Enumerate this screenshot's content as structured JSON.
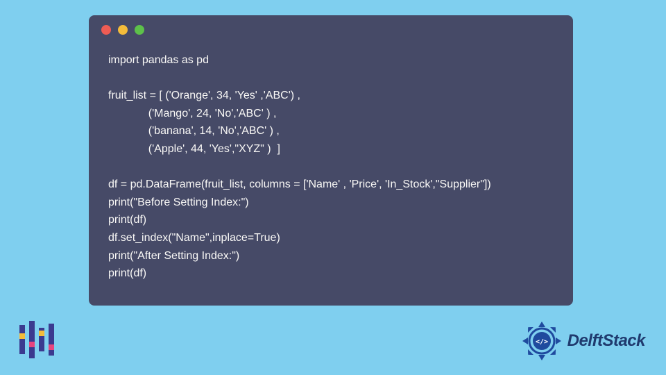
{
  "code": {
    "lines": [
      "import pandas as pd",
      "",
      "fruit_list = [ ('Orange', 34, 'Yes' ,'ABC') ,",
      "             ('Mango', 24, 'No','ABC' ) ,",
      "             ('banana', 14, 'No','ABC' ) ,",
      "             ('Apple', 44, 'Yes',\"XYZ\" )  ]",
      "",
      "df = pd.DataFrame(fruit_list, columns = ['Name' , 'Price', 'In_Stock',\"Supplier\"])",
      "print(\"Before Setting Index:\")",
      "print(df)",
      "df.set_index(\"Name\",inplace=True)",
      "print(\"After Setting Index:\")",
      "print(df)"
    ]
  },
  "brand": {
    "name": "DelftStack"
  },
  "colors": {
    "background": "#7fcfef",
    "codeBackground": "#464a67",
    "codeText": "#f9f8f6",
    "brandText": "#1f3a6e"
  }
}
